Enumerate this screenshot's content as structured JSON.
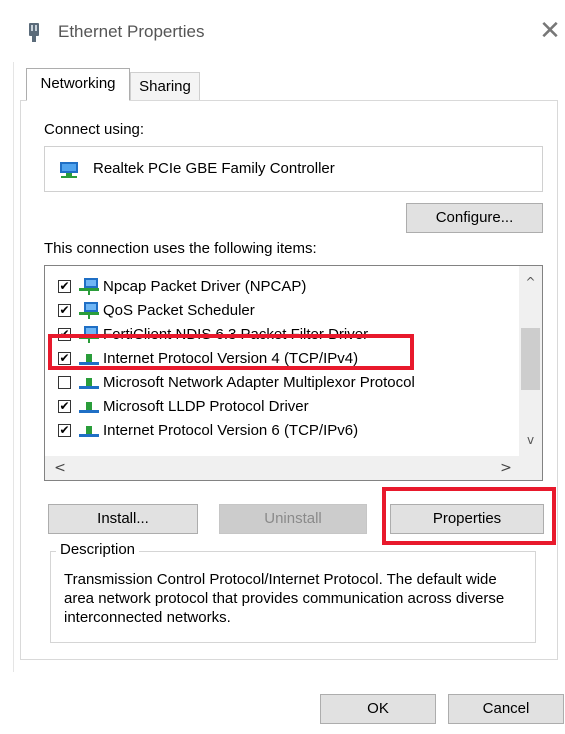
{
  "window": {
    "title": "Ethernet Properties",
    "close_glyph": "✕",
    "icon": "network-adapter-icon"
  },
  "tabs": [
    {
      "label": "Networking",
      "active": true
    },
    {
      "label": "Sharing",
      "active": false
    }
  ],
  "connect_using": {
    "label": "Connect using:",
    "adapter_name": "Realtek PCIe GBE Family Controller",
    "adapter_icon": "network-adapter-icon"
  },
  "configure_button": "Configure...",
  "items_section": {
    "label": "This connection uses the following items:",
    "items": [
      {
        "label": "Npcap Packet Driver (NPCAP)",
        "checked": true,
        "icon": "network-client-icon"
      },
      {
        "label": "QoS Packet Scheduler",
        "checked": true,
        "icon": "network-client-icon"
      },
      {
        "label": "FortiClient NDIS 6.3 Packet Filter Driver",
        "checked": true,
        "icon": "network-client-icon"
      },
      {
        "label": "Internet Protocol Version 4 (TCP/IPv4)",
        "checked": true,
        "icon": "protocol-icon",
        "selected": true
      },
      {
        "label": "Microsoft Network Adapter Multiplexor Protocol",
        "checked": false,
        "icon": "protocol-icon"
      },
      {
        "label": "Microsoft LLDP Protocol Driver",
        "checked": true,
        "icon": "protocol-icon"
      },
      {
        "label": "Internet Protocol Version 6 (TCP/IPv6)",
        "checked": true,
        "icon": "protocol-icon"
      }
    ],
    "scroll_up": "^",
    "scroll_down": "v",
    "scroll_left": "<",
    "scroll_right": ">"
  },
  "buttons": {
    "install": "Install...",
    "uninstall": "Uninstall",
    "properties": "Properties",
    "ok": "OK",
    "cancel": "Cancel"
  },
  "description": {
    "legend": "Description",
    "text": "Transmission Control Protocol/Internet Protocol. The default wide area network protocol that provides communication across diverse interconnected networks."
  },
  "colors": {
    "annotation": "#e8192c",
    "button_face": "#e1e1e1",
    "icon_green": "#2a9d3a",
    "icon_blue": "#1f6fc5"
  }
}
